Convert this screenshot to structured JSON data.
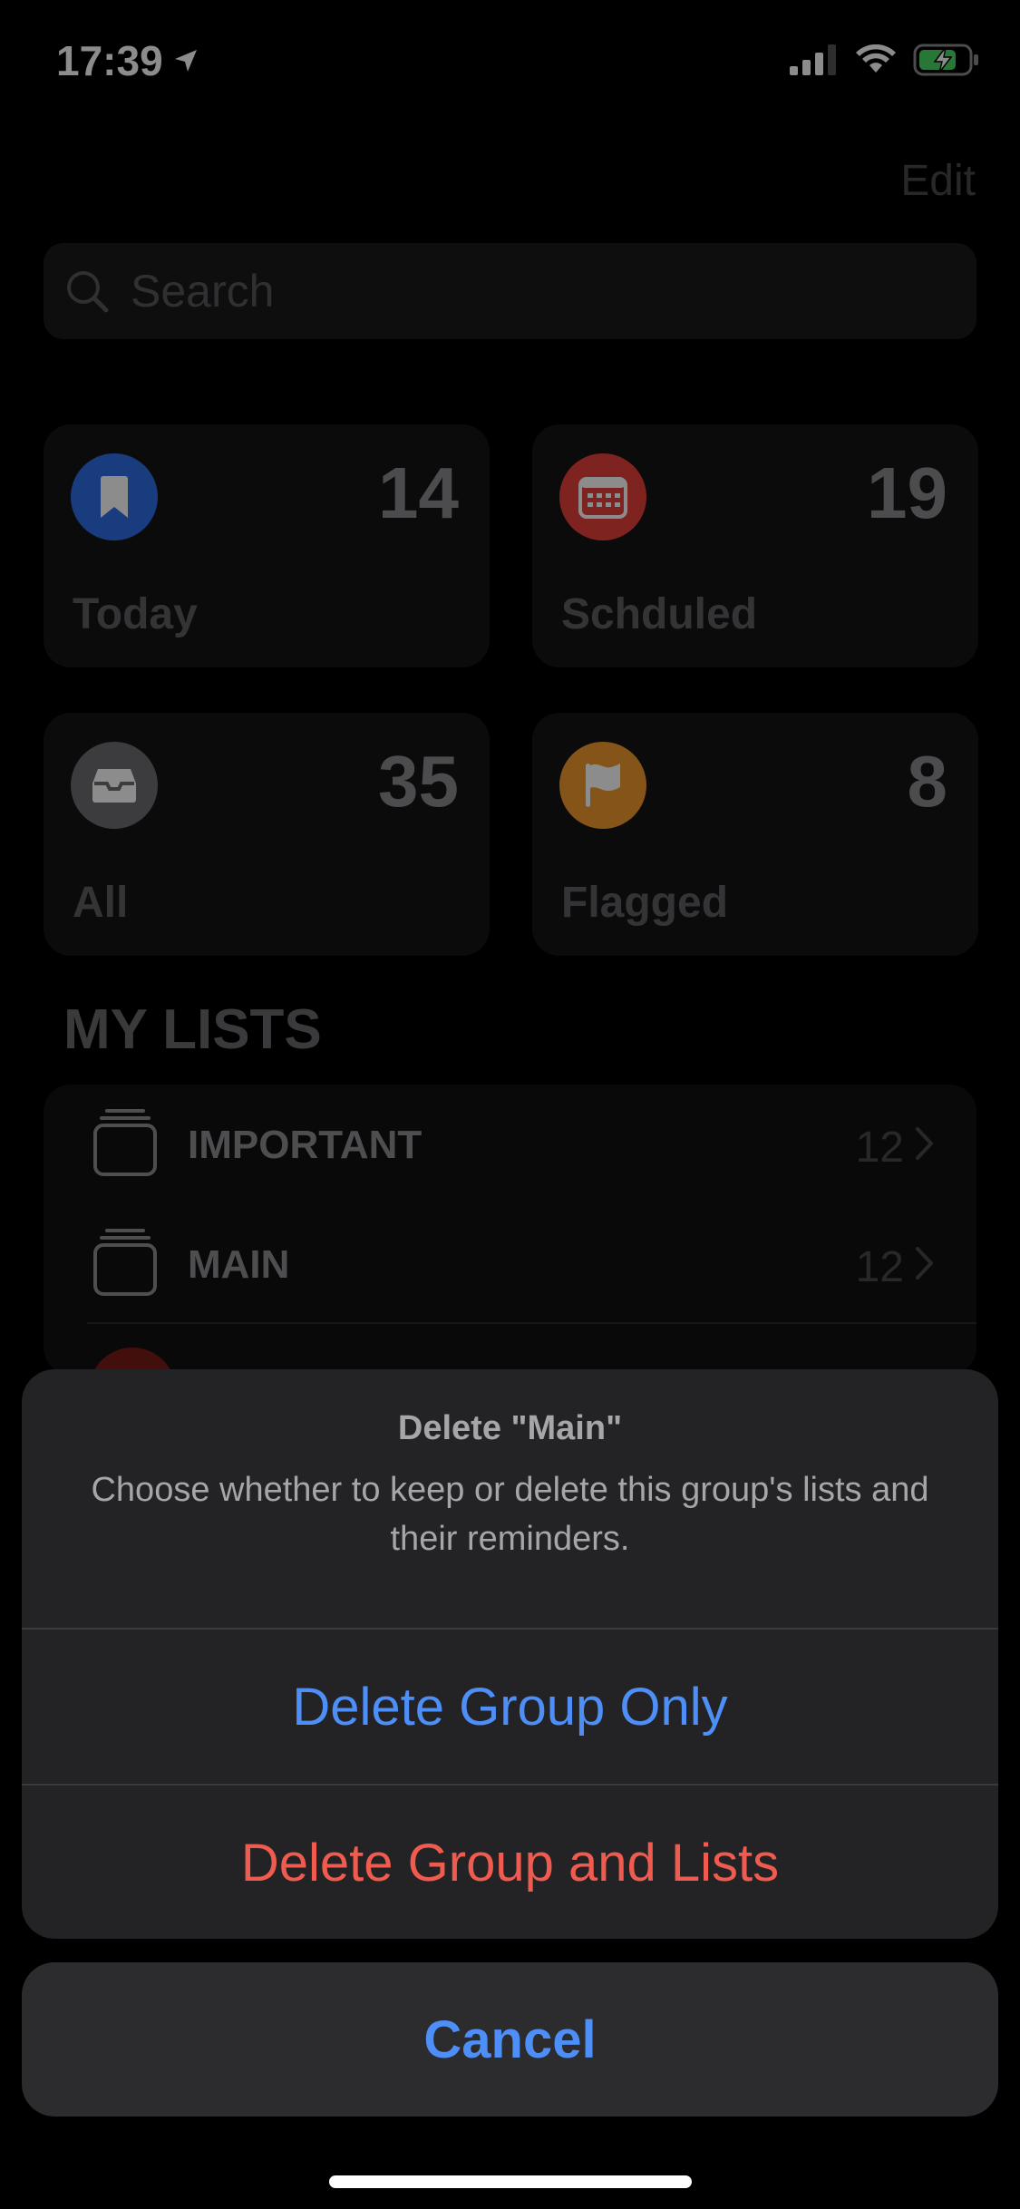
{
  "status_bar": {
    "time": "17:39"
  },
  "header": {
    "edit_label": "Edit"
  },
  "search": {
    "placeholder": "Search"
  },
  "smart_lists": [
    {
      "label": "Today",
      "count": "14",
      "icon": "bookmark-icon",
      "color": "#2f6ee6"
    },
    {
      "label": "Schduled",
      "count": "19",
      "icon": "calendar-icon",
      "color": "#e5413b"
    },
    {
      "label": "All",
      "count": "35",
      "icon": "tray-icon",
      "color": "#6e6e72"
    },
    {
      "label": "Flagged",
      "count": "8",
      "icon": "flag-icon",
      "color": "#f09a2f"
    }
  ],
  "my_lists": {
    "title": "MY LISTS",
    "items": [
      {
        "label": "IMPORTANT",
        "count": "12",
        "icon": "group-stack-icon"
      },
      {
        "label": "MAIN",
        "count": "12",
        "icon": "group-stack-icon"
      }
    ]
  },
  "action_sheet": {
    "title": "Delete \"Main\"",
    "message": "Choose whether to keep or delete this group's lists and their reminders.",
    "delete_group_only": "Delete Group Only",
    "delete_group_and_lists": "Delete Group and Lists",
    "cancel": "Cancel"
  },
  "colors": {
    "accent_blue": "#4e8ef7",
    "destructive_red": "#ef5b4f"
  }
}
